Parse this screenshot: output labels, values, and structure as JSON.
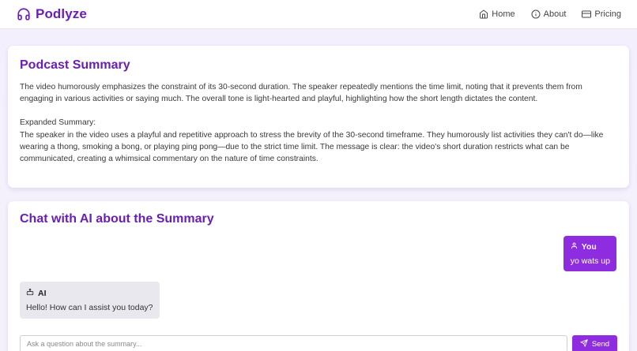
{
  "brand": {
    "name": "Podlyze",
    "icon": "headphones-icon",
    "accent": "#6a1fb3"
  },
  "nav": {
    "items": [
      {
        "label": "Home",
        "icon": "home-icon"
      },
      {
        "label": "About",
        "icon": "info-icon"
      },
      {
        "label": "Pricing",
        "icon": "credit-card-icon"
      }
    ]
  },
  "summary": {
    "title": "Podcast Summary",
    "paragraph": "The video humorously emphasizes the constraint of its 30-second duration. The speaker repeatedly mentions the time limit, noting that it prevents them from engaging in various activities or saying much. The overall tone is light-hearted and playful, highlighting how the short length dictates the content.",
    "expanded_label": "Expanded Summary:",
    "expanded_text": "The speaker in the video uses a playful and repetitive approach to stress the brevity of the 30-second timeframe. They humorously list activities they can't do—like wearing a thong, smoking a bong, or playing ping pong—due to the strict time limit. The message is clear: the video's short duration restricts what can be communicated, creating a whimsical commentary on the nature of time constraints."
  },
  "chat": {
    "title": "Chat with AI about the Summary",
    "messages": [
      {
        "role": "user",
        "sender": "You",
        "text": "yo wats up",
        "icon": "user-icon"
      },
      {
        "role": "ai",
        "sender": "AI",
        "text": "Hello! How can I assist you today?",
        "icon": "robot-icon"
      }
    ],
    "input": {
      "placeholder": "Ask a question about the summary...",
      "value": ""
    },
    "send_label": "Send",
    "send_icon": "send-icon",
    "colors": {
      "user_bubble": "#8e2ce0",
      "ai_bubble": "#e9e8ee"
    }
  }
}
